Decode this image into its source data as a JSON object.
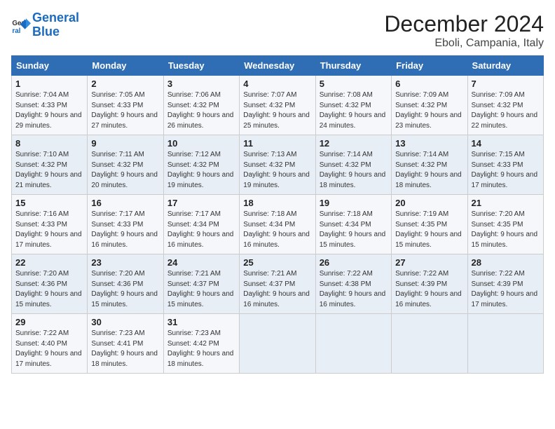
{
  "logo": {
    "line1": "General",
    "line2": "Blue"
  },
  "title": "December 2024",
  "location": "Eboli, Campania, Italy",
  "weekdays": [
    "Sunday",
    "Monday",
    "Tuesday",
    "Wednesday",
    "Thursday",
    "Friday",
    "Saturday"
  ],
  "weeks": [
    [
      {
        "day": "1",
        "sunrise": "Sunrise: 7:04 AM",
        "sunset": "Sunset: 4:33 PM",
        "daylight": "Daylight: 9 hours and 29 minutes."
      },
      {
        "day": "2",
        "sunrise": "Sunrise: 7:05 AM",
        "sunset": "Sunset: 4:33 PM",
        "daylight": "Daylight: 9 hours and 27 minutes."
      },
      {
        "day": "3",
        "sunrise": "Sunrise: 7:06 AM",
        "sunset": "Sunset: 4:32 PM",
        "daylight": "Daylight: 9 hours and 26 minutes."
      },
      {
        "day": "4",
        "sunrise": "Sunrise: 7:07 AM",
        "sunset": "Sunset: 4:32 PM",
        "daylight": "Daylight: 9 hours and 25 minutes."
      },
      {
        "day": "5",
        "sunrise": "Sunrise: 7:08 AM",
        "sunset": "Sunset: 4:32 PM",
        "daylight": "Daylight: 9 hours and 24 minutes."
      },
      {
        "day": "6",
        "sunrise": "Sunrise: 7:09 AM",
        "sunset": "Sunset: 4:32 PM",
        "daylight": "Daylight: 9 hours and 23 minutes."
      },
      {
        "day": "7",
        "sunrise": "Sunrise: 7:09 AM",
        "sunset": "Sunset: 4:32 PM",
        "daylight": "Daylight: 9 hours and 22 minutes."
      }
    ],
    [
      {
        "day": "8",
        "sunrise": "Sunrise: 7:10 AM",
        "sunset": "Sunset: 4:32 PM",
        "daylight": "Daylight: 9 hours and 21 minutes."
      },
      {
        "day": "9",
        "sunrise": "Sunrise: 7:11 AM",
        "sunset": "Sunset: 4:32 PM",
        "daylight": "Daylight: 9 hours and 20 minutes."
      },
      {
        "day": "10",
        "sunrise": "Sunrise: 7:12 AM",
        "sunset": "Sunset: 4:32 PM",
        "daylight": "Daylight: 9 hours and 19 minutes."
      },
      {
        "day": "11",
        "sunrise": "Sunrise: 7:13 AM",
        "sunset": "Sunset: 4:32 PM",
        "daylight": "Daylight: 9 hours and 19 minutes."
      },
      {
        "day": "12",
        "sunrise": "Sunrise: 7:14 AM",
        "sunset": "Sunset: 4:32 PM",
        "daylight": "Daylight: 9 hours and 18 minutes."
      },
      {
        "day": "13",
        "sunrise": "Sunrise: 7:14 AM",
        "sunset": "Sunset: 4:32 PM",
        "daylight": "Daylight: 9 hours and 18 minutes."
      },
      {
        "day": "14",
        "sunrise": "Sunrise: 7:15 AM",
        "sunset": "Sunset: 4:33 PM",
        "daylight": "Daylight: 9 hours and 17 minutes."
      }
    ],
    [
      {
        "day": "15",
        "sunrise": "Sunrise: 7:16 AM",
        "sunset": "Sunset: 4:33 PM",
        "daylight": "Daylight: 9 hours and 17 minutes."
      },
      {
        "day": "16",
        "sunrise": "Sunrise: 7:17 AM",
        "sunset": "Sunset: 4:33 PM",
        "daylight": "Daylight: 9 hours and 16 minutes."
      },
      {
        "day": "17",
        "sunrise": "Sunrise: 7:17 AM",
        "sunset": "Sunset: 4:34 PM",
        "daylight": "Daylight: 9 hours and 16 minutes."
      },
      {
        "day": "18",
        "sunrise": "Sunrise: 7:18 AM",
        "sunset": "Sunset: 4:34 PM",
        "daylight": "Daylight: 9 hours and 16 minutes."
      },
      {
        "day": "19",
        "sunrise": "Sunrise: 7:18 AM",
        "sunset": "Sunset: 4:34 PM",
        "daylight": "Daylight: 9 hours and 15 minutes."
      },
      {
        "day": "20",
        "sunrise": "Sunrise: 7:19 AM",
        "sunset": "Sunset: 4:35 PM",
        "daylight": "Daylight: 9 hours and 15 minutes."
      },
      {
        "day": "21",
        "sunrise": "Sunrise: 7:20 AM",
        "sunset": "Sunset: 4:35 PM",
        "daylight": "Daylight: 9 hours and 15 minutes."
      }
    ],
    [
      {
        "day": "22",
        "sunrise": "Sunrise: 7:20 AM",
        "sunset": "Sunset: 4:36 PM",
        "daylight": "Daylight: 9 hours and 15 minutes."
      },
      {
        "day": "23",
        "sunrise": "Sunrise: 7:20 AM",
        "sunset": "Sunset: 4:36 PM",
        "daylight": "Daylight: 9 hours and 15 minutes."
      },
      {
        "day": "24",
        "sunrise": "Sunrise: 7:21 AM",
        "sunset": "Sunset: 4:37 PM",
        "daylight": "Daylight: 9 hours and 15 minutes."
      },
      {
        "day": "25",
        "sunrise": "Sunrise: 7:21 AM",
        "sunset": "Sunset: 4:37 PM",
        "daylight": "Daylight: 9 hours and 16 minutes."
      },
      {
        "day": "26",
        "sunrise": "Sunrise: 7:22 AM",
        "sunset": "Sunset: 4:38 PM",
        "daylight": "Daylight: 9 hours and 16 minutes."
      },
      {
        "day": "27",
        "sunrise": "Sunrise: 7:22 AM",
        "sunset": "Sunset: 4:39 PM",
        "daylight": "Daylight: 9 hours and 16 minutes."
      },
      {
        "day": "28",
        "sunrise": "Sunrise: 7:22 AM",
        "sunset": "Sunset: 4:39 PM",
        "daylight": "Daylight: 9 hours and 17 minutes."
      }
    ],
    [
      {
        "day": "29",
        "sunrise": "Sunrise: 7:22 AM",
        "sunset": "Sunset: 4:40 PM",
        "daylight": "Daylight: 9 hours and 17 minutes."
      },
      {
        "day": "30",
        "sunrise": "Sunrise: 7:23 AM",
        "sunset": "Sunset: 4:41 PM",
        "daylight": "Daylight: 9 hours and 18 minutes."
      },
      {
        "day": "31",
        "sunrise": "Sunrise: 7:23 AM",
        "sunset": "Sunset: 4:42 PM",
        "daylight": "Daylight: 9 hours and 18 minutes."
      },
      null,
      null,
      null,
      null
    ]
  ]
}
